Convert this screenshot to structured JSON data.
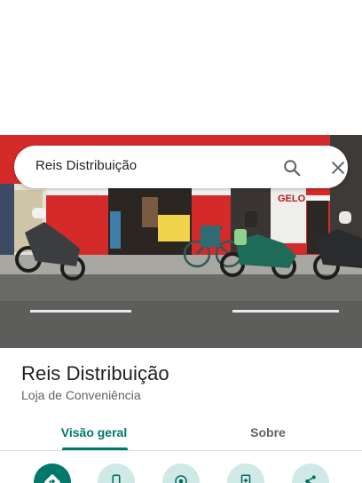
{
  "search": {
    "query": "Reis Distribuição",
    "search_icon": "search-icon",
    "close_icon": "close-icon"
  },
  "photo": {
    "sign_text": "GELO",
    "description_icon": "storefront-photo"
  },
  "place": {
    "name": "Reis Distribuição",
    "category": "Loja de Conveniência"
  },
  "tabs": [
    {
      "label": "Visão geral",
      "selected": true
    },
    {
      "label": "Sobre",
      "selected": false
    }
  ],
  "actions": [
    {
      "icon": "directions-icon",
      "primary": true
    },
    {
      "icon": "phone-icon",
      "primary": false
    },
    {
      "icon": "place-icon",
      "primary": false
    },
    {
      "icon": "save-icon",
      "primary": false
    },
    {
      "icon": "share-icon",
      "primary": false
    }
  ],
  "colors": {
    "accent": "#00796b",
    "accent_light": "#cfe9e6",
    "storefront_red": "#d42a2a"
  }
}
